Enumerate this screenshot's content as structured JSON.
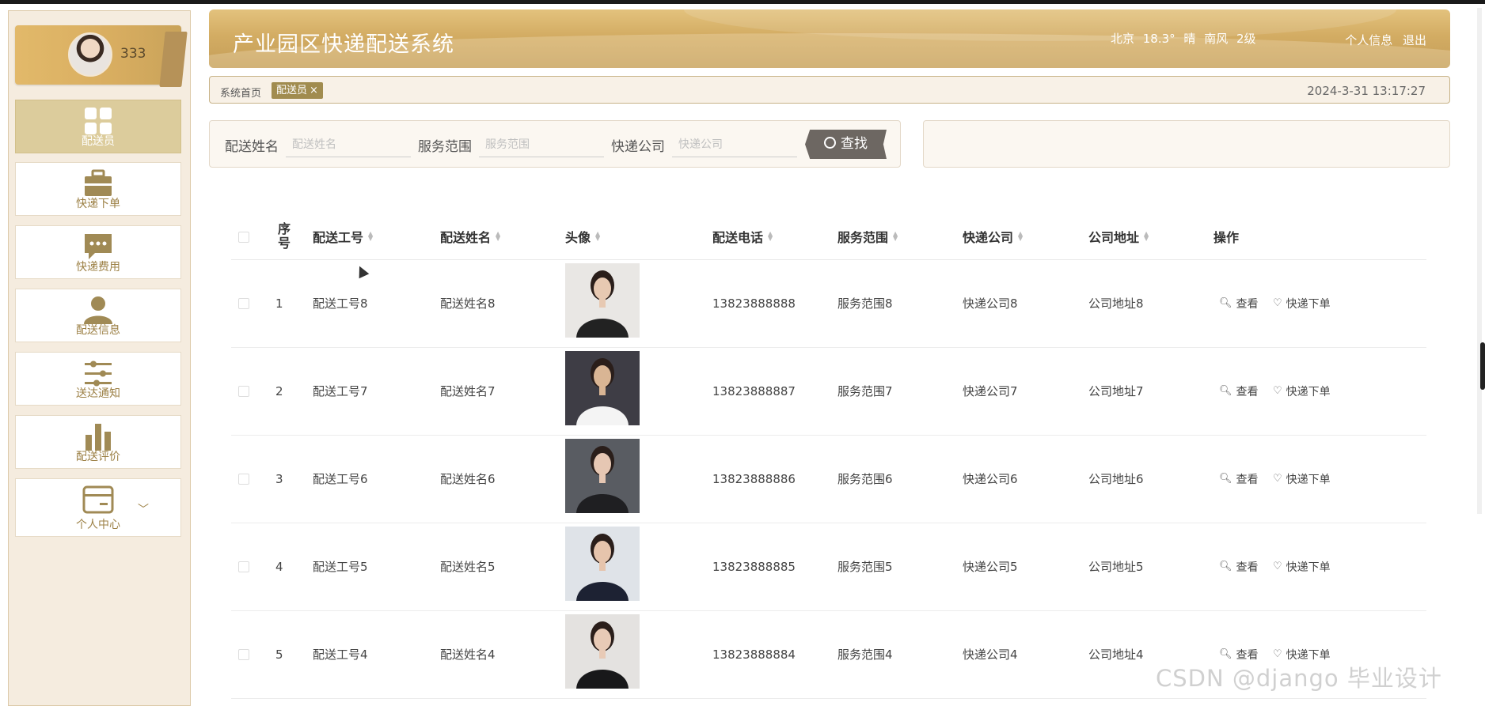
{
  "user": {
    "name": "333"
  },
  "sidebar": {
    "items": [
      {
        "label": "配送员",
        "icon": "grid-icon",
        "active": true
      },
      {
        "label": "快递下单",
        "icon": "briefcase-icon"
      },
      {
        "label": "快递费用",
        "icon": "chat-icon"
      },
      {
        "label": "配送信息",
        "icon": "person-icon"
      },
      {
        "label": "送达通知",
        "icon": "sliders-icon"
      },
      {
        "label": "配送评价",
        "icon": "bar-chart-icon"
      },
      {
        "label": "个人中心",
        "icon": "card-icon",
        "expandable": true
      }
    ]
  },
  "header": {
    "title": "产业园区快递配送系统",
    "weather": "北京 18.3° 晴 南风 2级",
    "profile_link": "个人信息",
    "logout_link": "退出"
  },
  "breadcrumb": {
    "home": "系统首页",
    "current": "配送员",
    "close": "×",
    "datetime": "2024-3-31 13:17:27"
  },
  "search": {
    "name_label": "配送姓名",
    "name_placeholder": "配送姓名",
    "scope_label": "服务范围",
    "scope_placeholder": "服务范围",
    "company_label": "快递公司",
    "company_placeholder": "快递公司",
    "button": "查找"
  },
  "table": {
    "columns": [
      "序号",
      "配送工号",
      "配送姓名",
      "头像",
      "配送电话",
      "服务范围",
      "快递公司",
      "公司地址",
      "操作"
    ],
    "view_action": "查看",
    "order_action": "快递下单",
    "rows": [
      {
        "index": "1",
        "worker_id": "配送工号8",
        "name": "配送姓名8",
        "phone": "13823888888",
        "scope": "服务范围8",
        "company": "快递公司8",
        "address": "公司地址8"
      },
      {
        "index": "2",
        "worker_id": "配送工号7",
        "name": "配送姓名7",
        "phone": "13823888887",
        "scope": "服务范围7",
        "company": "快递公司7",
        "address": "公司地址7"
      },
      {
        "index": "3",
        "worker_id": "配送工号6",
        "name": "配送姓名6",
        "phone": "13823888886",
        "scope": "服务范围6",
        "company": "快递公司6",
        "address": "公司地址6"
      },
      {
        "index": "4",
        "worker_id": "配送工号5",
        "name": "配送姓名5",
        "phone": "13823888885",
        "scope": "服务范围5",
        "company": "快递公司5",
        "address": "公司地址5"
      },
      {
        "index": "5",
        "worker_id": "配送工号4",
        "name": "配送姓名4",
        "phone": "13823888884",
        "scope": "服务范围4",
        "company": "快递公司4",
        "address": "公司地址4"
      }
    ]
  },
  "watermark": "CSDN @django 毕业设计",
  "colors": {
    "accent": "#d3ac63",
    "sidebar_bg": "#f5ecdf",
    "active_nav": "#dccc9c",
    "button": "#6d6762"
  }
}
